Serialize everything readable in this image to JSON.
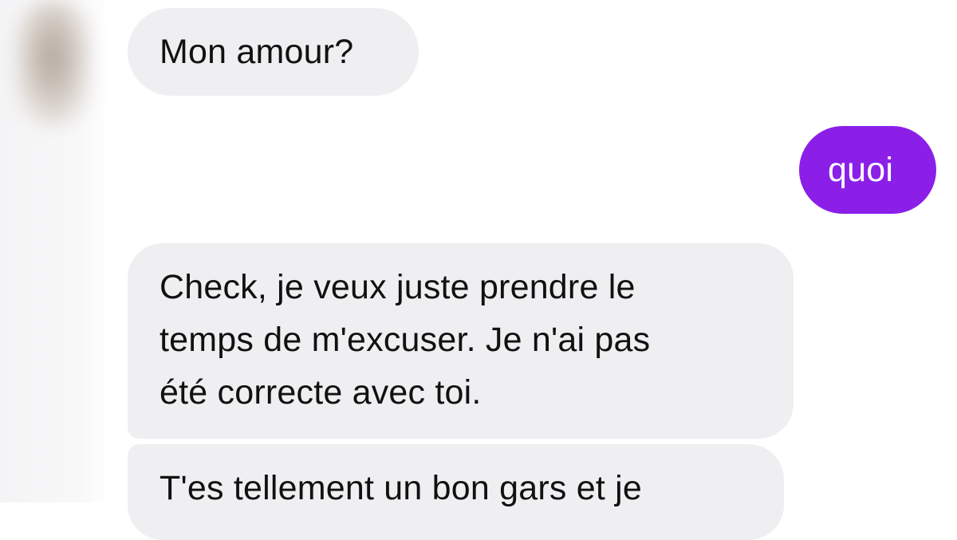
{
  "conversation": {
    "messages": [
      {
        "direction": "incoming",
        "text": "Mon amour?"
      },
      {
        "direction": "outgoing",
        "text": "quoi"
      },
      {
        "direction": "incoming",
        "text": "Check, je veux juste prendre le\ntemps de m'excuser. Je n'ai pas\nété correcte avec toi."
      },
      {
        "direction": "incoming",
        "text": "T'es tellement un bon gars et je"
      }
    ]
  },
  "colors": {
    "incoming_bubble": "#efeff1",
    "outgoing_bubble": "#8b1fe8",
    "incoming_text": "#111111",
    "outgoing_text": "#ffffff"
  }
}
